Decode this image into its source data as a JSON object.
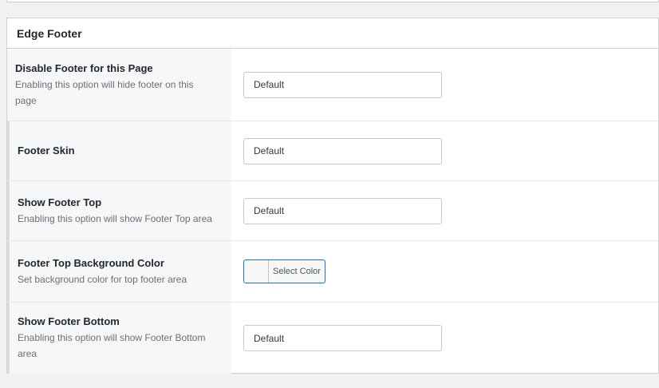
{
  "panel": {
    "title": "Edge Footer"
  },
  "rows": [
    {
      "label": "Disable Footer for this Page",
      "description": "Enabling this option will hide footer on this page",
      "value": "Default"
    },
    {
      "label": "Footer Skin",
      "description": "",
      "value": "Default"
    },
    {
      "label": "Show Footer Top",
      "description": "Enabling this option will show Footer Top area",
      "value": "Default"
    },
    {
      "label": "Footer Top Background Color",
      "description": "Set background color for top footer area",
      "button_label": "Select Color"
    },
    {
      "label": "Show Footer Bottom",
      "description": "Enabling this option will show Footer Bottom area",
      "value": "Default"
    }
  ],
  "colors": {
    "label_bg": "#f6f7f9",
    "accent": "#2271b1"
  }
}
